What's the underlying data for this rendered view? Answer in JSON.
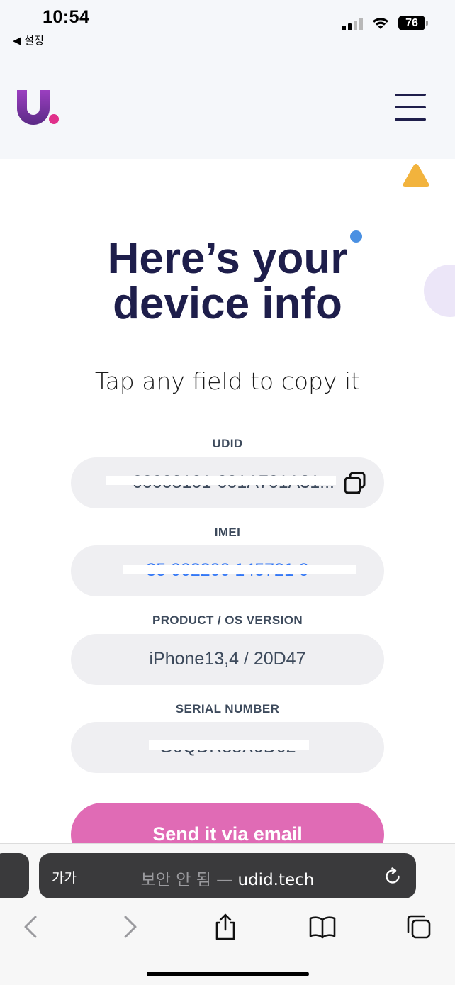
{
  "status_bar": {
    "time": "10:54",
    "back_label": "◀ 설정",
    "battery": "76"
  },
  "header": {
    "logo_icon": "udid-logo-icon",
    "menu_icon": "hamburger-menu-icon"
  },
  "hero": {
    "headline_line1": "Here’s your",
    "headline_line2": "device info",
    "subline": "Tap any field to copy it"
  },
  "fields": [
    {
      "label": "UDID",
      "value": "00008101-001A701A31..."
    },
    {
      "label": "IMEI",
      "value": "35 002200 145721 0"
    },
    {
      "label": "PRODUCT / OS VERSION",
      "value": "iPhone13,4 / 20D47"
    },
    {
      "label": "SERIAL NUMBER",
      "value": "G0QDR88X0D02"
    }
  ],
  "email_button": {
    "label": "Send it via email"
  },
  "browser": {
    "aa_label": "가가",
    "insecure_label": "보안 안 됨 — ",
    "domain": "udid.tech"
  },
  "colors": {
    "navy": "#1e1e4b",
    "accent_pink": "#e06bb5",
    "link_blue": "#3478f6",
    "triangle_yellow": "#f2b33d",
    "dot_blue": "#4a90e2",
    "field_bg": "#efeff2"
  }
}
